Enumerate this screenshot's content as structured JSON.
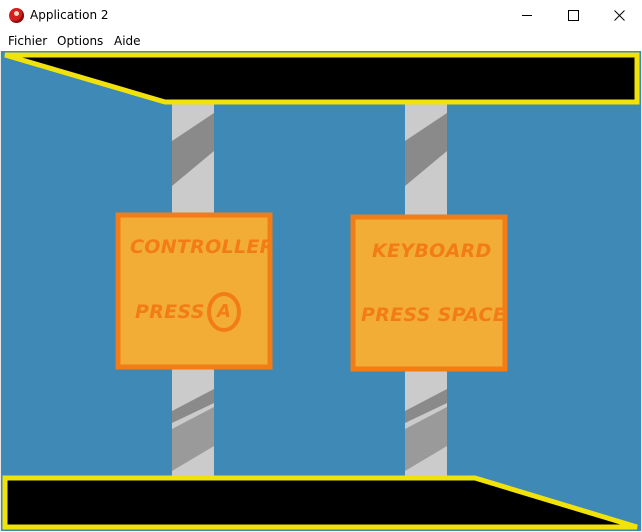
{
  "window": {
    "title": "Application 2",
    "controls": [
      "minimize-icon",
      "maximize-icon",
      "close-icon"
    ]
  },
  "menu": {
    "items": [
      "Fichier",
      "Options",
      "Aide"
    ]
  },
  "game": {
    "colors": {
      "background": "#3f89b6",
      "border_yellow": "#f1e20a",
      "bar_black": "#000000",
      "panel_fill": "#f2ad37",
      "panel_border": "#f27c16",
      "pillar_light": "#cbcbcb",
      "pillar_dark": "#8a8a8a"
    },
    "controller_panel": {
      "heading": "CONTROLLER",
      "prompt": "PRESS",
      "button_glyph": "A"
    },
    "keyboard_panel": {
      "heading": "KEYBOARD",
      "prompt": "PRESS SPACE"
    }
  }
}
